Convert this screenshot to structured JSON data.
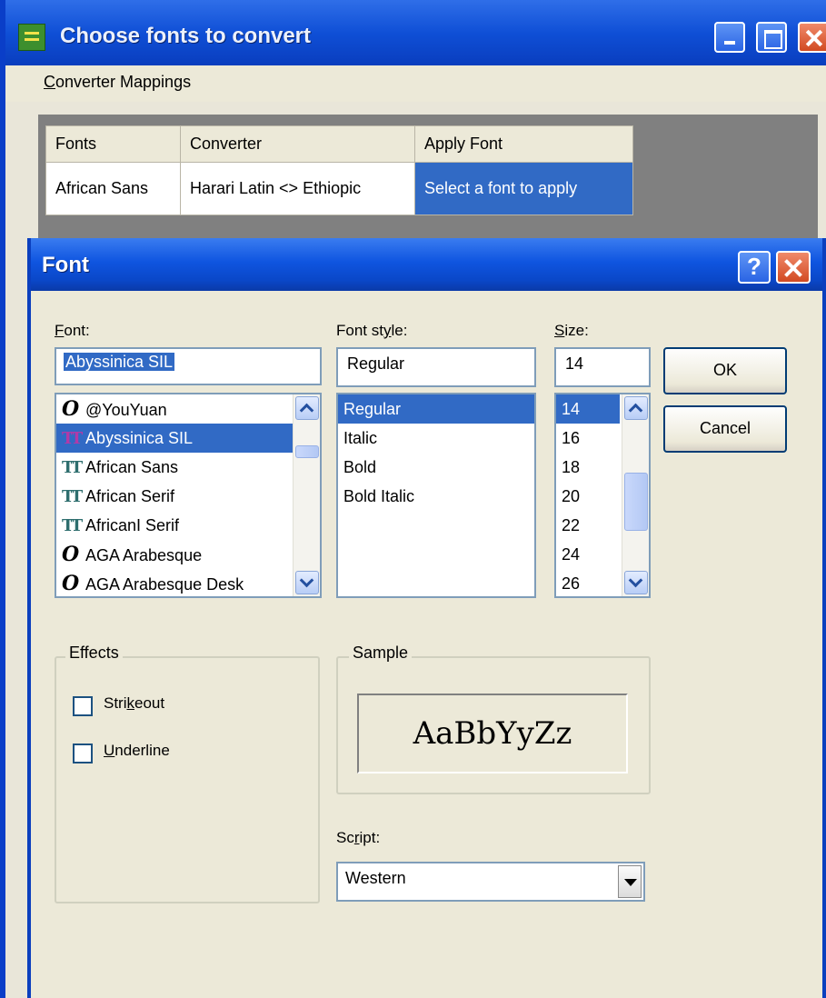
{
  "back_window": {
    "title": "Choose fonts to convert",
    "menu": {
      "label_underlined": "C",
      "label_rest": "onverter Mappings"
    },
    "table": {
      "headers": [
        "Fonts",
        "Converter",
        "Apply Font"
      ],
      "row": [
        "African Sans",
        "Harari Latin <> Ethiopic",
        "Select a font to apply"
      ]
    }
  },
  "font_dialog": {
    "title": "Font",
    "help_label": "?",
    "font": {
      "label_underlined": "F",
      "label_rest": "ont:",
      "value": "Abyssinica SIL",
      "items": [
        {
          "label": "@YouYuan",
          "icon": "opentype-icon"
        },
        {
          "label": "Abyssinica SIL",
          "icon": "truetype-icon",
          "selected": true
        },
        {
          "label": "African Sans",
          "icon": "truetype-icon"
        },
        {
          "label": "African Serif",
          "icon": "truetype-icon"
        },
        {
          "label": "AfricanI Serif",
          "icon": "truetype-icon"
        },
        {
          "label": "AGA Arabesque",
          "icon": "opentype-icon"
        },
        {
          "label": "AGA Arabesque Desk",
          "icon": "opentype-icon"
        }
      ]
    },
    "style": {
      "label_pre": "Font st",
      "label_underlined": "y",
      "label_rest": "le:",
      "value": "Regular",
      "items": [
        "Regular",
        "Italic",
        "Bold",
        "Bold Italic"
      ],
      "selected": "Regular"
    },
    "size": {
      "label_underlined": "S",
      "label_rest": "ize:",
      "value": "14",
      "items": [
        "14",
        "16",
        "18",
        "20",
        "22",
        "24",
        "26"
      ],
      "selected": "14"
    },
    "ok_label": "OK",
    "cancel_label": "Cancel",
    "effects": {
      "legend": "Effects",
      "strikeout_pre": "Stri",
      "strikeout_underlined": "k",
      "strikeout_rest": "eout",
      "underline_underlined": "U",
      "underline_rest": "nderline"
    },
    "sample": {
      "legend": "Sample",
      "text": "AaBbYyZz"
    },
    "script": {
      "label_pre": "Sc",
      "label_underlined": "r",
      "label_rest": "ipt:",
      "value": "Western"
    }
  }
}
